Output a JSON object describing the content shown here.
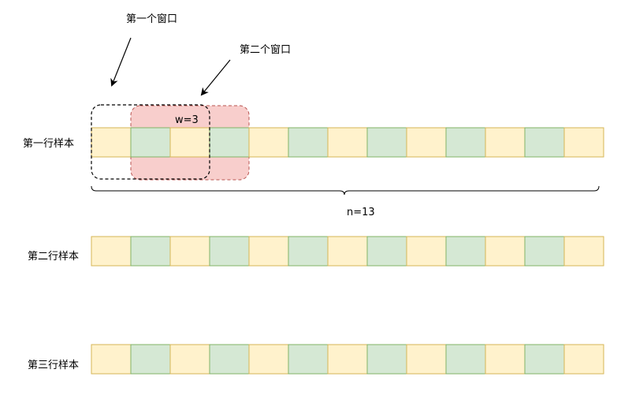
{
  "labels": {
    "window_1": "第一个窗口",
    "window_2": "第二个窗口",
    "window_size": "w=3",
    "length": "n=13"
  },
  "rows": [
    {
      "label": "第一行样本",
      "cells": [
        "y",
        "g",
        "y",
        "g",
        "y",
        "g",
        "y",
        "g",
        "y",
        "g",
        "y",
        "g",
        "y"
      ]
    },
    {
      "label": "第二行样本",
      "cells": [
        "y",
        "g",
        "y",
        "g",
        "y",
        "g",
        "y",
        "g",
        "y",
        "g",
        "y",
        "g",
        "y"
      ]
    },
    {
      "label": "第三行样本",
      "cells": [
        "y",
        "g",
        "y",
        "g",
        "y",
        "g",
        "y",
        "g",
        "y",
        "g",
        "y",
        "g",
        "y"
      ]
    }
  ],
  "colors": {
    "cell_yellow_fill": "#fff2cc",
    "cell_yellow_stroke": "#d6b656",
    "cell_green_fill": "#d5e8d4",
    "cell_green_stroke": "#82b366",
    "window_2_fill": "#f8cecc",
    "window_2_stroke": "#b85450",
    "window_1_stroke": "#000000"
  }
}
